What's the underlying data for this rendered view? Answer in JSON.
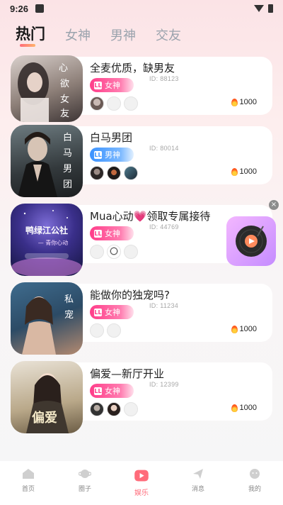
{
  "status": {
    "time": "9:26"
  },
  "tabs": [
    {
      "label": "热门",
      "active": true
    },
    {
      "label": "女神",
      "active": false
    },
    {
      "label": "男神",
      "active": false
    },
    {
      "label": "交友",
      "active": false
    }
  ],
  "rooms": [
    {
      "title": "全麦优质，缺男友",
      "badge": "女神",
      "badge_type": "female",
      "room_id": "ID: 88123",
      "heat": "1000",
      "cover_text": "心动女友"
    },
    {
      "title": "白马男团",
      "badge": "男神",
      "badge_type": "male",
      "room_id": "ID: 80014",
      "heat": "1000",
      "cover_text": "白马男团"
    },
    {
      "title": "Mua心动💗领取专属接待",
      "badge": "女神",
      "badge_type": "female",
      "room_id": "ID: 44769",
      "heat": "",
      "cover_text": "鸭绿江公社"
    },
    {
      "title": "能做你的独宠吗?",
      "badge": "女神",
      "badge_type": "female",
      "room_id": "ID: 11234",
      "heat": "1000",
      "cover_text": "私宠"
    },
    {
      "title": "偏爱—新厅开业",
      "badge": "女神",
      "badge_type": "female",
      "room_id": "ID: 12399",
      "heat": "1000",
      "cover_text": "偏爱"
    }
  ],
  "nav": [
    {
      "label": "首页",
      "icon": "home-icon"
    },
    {
      "label": "圈子",
      "icon": "planet-icon"
    },
    {
      "label": "娱乐",
      "icon": "play-icon",
      "active": true
    },
    {
      "label": "消息",
      "icon": "send-icon"
    },
    {
      "label": "我的",
      "icon": "face-icon"
    }
  ],
  "colors": {
    "accent": "#ff6b7a",
    "female": "#ff3d8a",
    "male": "#3a92ff"
  }
}
